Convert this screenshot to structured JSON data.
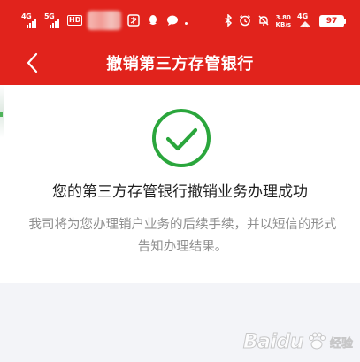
{
  "status_bar": {
    "signal_1": "4G",
    "signal_2": "5G",
    "hd_label": "HD",
    "network_speed_value": "3.80",
    "network_speed_unit": "KB/s",
    "network_type": "4G",
    "battery_level": "97"
  },
  "nav": {
    "title": "撤销第三方存管银行"
  },
  "result": {
    "title": "您的第三方存管银行撤销业务办理成功",
    "description": "我司将为您办理销户业务的后续手续，并以短信的形式告知办理结果。"
  },
  "watermark": {
    "brand": "Baidu",
    "suffix": "经验"
  },
  "colors": {
    "header_red": "#e1231c",
    "success_green": "#2aa63c",
    "content_bg": "#ffffff",
    "page_bg": "#f3f4f8"
  },
  "icons": [
    "chevron-left-icon",
    "check-circle-icon",
    "bluetooth-icon",
    "alarm-icon",
    "mute-icon",
    "battery-icon",
    "wifi-icon",
    "chat-icon"
  ]
}
